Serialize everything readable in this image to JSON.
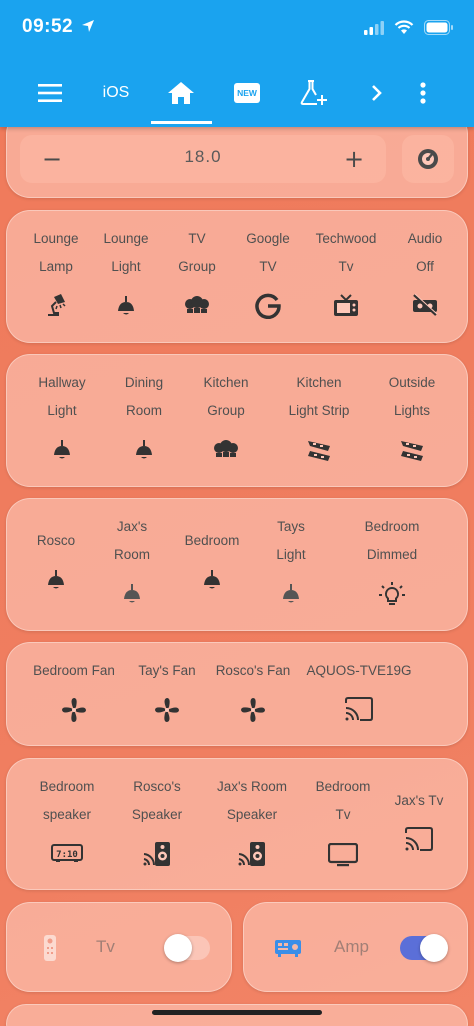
{
  "status": {
    "time": "09:52"
  },
  "nav": {
    "ios_label": "iOS",
    "new_badge": "NEW"
  },
  "thermostat": {
    "value": "18.0",
    "minus": "−",
    "plus": "+"
  },
  "cards": {
    "entertainment": [
      {
        "l1": "Lounge",
        "l2": "Lamp",
        "icon": "desk-lamp-icon"
      },
      {
        "l1": "Lounge",
        "l2": "Light",
        "icon": "ceiling-light-icon"
      },
      {
        "l1": "TV",
        "l2": "Group",
        "icon": "bulb-group-icon"
      },
      {
        "l1": "Google",
        "l2": "TV",
        "icon": "google-icon"
      },
      {
        "l1": "Techwood",
        "l2": "Tv",
        "icon": "television-classic-icon"
      },
      {
        "l1": "Audio",
        "l2": "Off",
        "icon": "audio-off-icon"
      }
    ],
    "hallway": [
      {
        "l1": "Hallway",
        "l2": "Light",
        "icon": "ceiling-light-icon"
      },
      {
        "l1": "Dining",
        "l2": "Room",
        "icon": "ceiling-light-icon"
      },
      {
        "l1": "Kitchen",
        "l2": "Group",
        "icon": "bulb-group-icon"
      },
      {
        "l1": "Kitchen",
        "l2": "Light Strip",
        "icon": "led-strip-icon"
      },
      {
        "l1": "Outside",
        "l2": "Lights",
        "icon": "led-strip-icon"
      }
    ],
    "bedrooms": [
      {
        "l1": "Rosco",
        "l2": "",
        "icon": "ceiling-light-icon"
      },
      {
        "l1": "Jax's",
        "l2": "Room",
        "icon": "ceiling-light-icon"
      },
      {
        "l1": "Bedroom",
        "l2": "",
        "icon": "ceiling-light-icon"
      },
      {
        "l1": "Tays",
        "l2": "Light",
        "icon": "ceiling-light-icon"
      },
      {
        "l1": "Bedroom",
        "l2": "Dimmed",
        "icon": "lightbulb-on-icon"
      }
    ],
    "fans": [
      {
        "l1": "Bedroom Fan",
        "icon": "fan-icon"
      },
      {
        "l1": "Tay's Fan",
        "icon": "fan-icon"
      },
      {
        "l1": "Rosco's Fan",
        "icon": "fan-icon"
      },
      {
        "l1": "AQUOS-TVE19G",
        "icon": "cast-icon"
      }
    ],
    "media": [
      {
        "l1": "Bedroom",
        "l2": "speaker",
        "icon": "clock-display-icon"
      },
      {
        "l1": "Rosco's",
        "l2": "Speaker",
        "icon": "speaker-cast-icon"
      },
      {
        "l1": "Jax's Room",
        "l2": "Speaker",
        "icon": "speaker-cast-icon"
      },
      {
        "l1": "Bedroom",
        "l2": "Tv",
        "icon": "tv-icon"
      },
      {
        "l1": "Jax's Tv",
        "l2": "",
        "icon": "cast-icon"
      }
    ]
  },
  "toggles": {
    "tv": {
      "label": "Tv",
      "on": false
    },
    "amp": {
      "label": "Amp",
      "on": true
    }
  },
  "colors": {
    "header": "#1aa3ef",
    "amp_accent": "#3a8ee8",
    "switch_on": "#5b6fd8"
  }
}
